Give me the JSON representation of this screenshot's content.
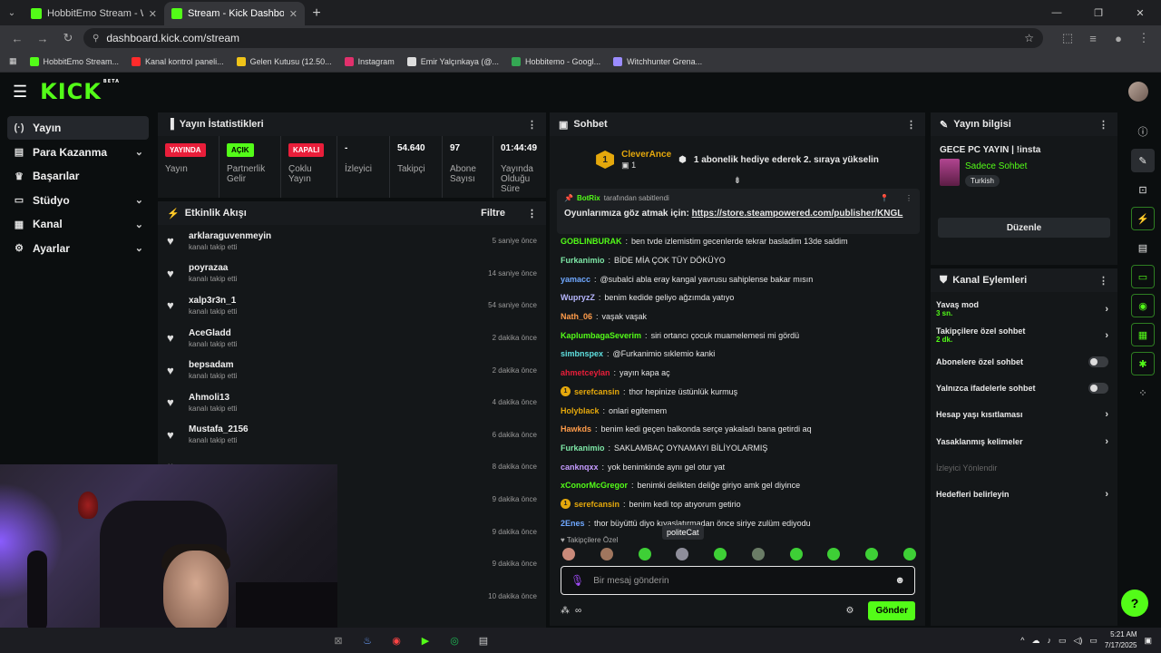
{
  "browser": {
    "tabs": [
      {
        "title": "HobbitEmo Stream - Watch Live",
        "active": false
      },
      {
        "title": "Stream - Kick Dashboard",
        "active": true
      }
    ],
    "url": "dashboard.kick.com/stream",
    "bookmarks": [
      {
        "label": "HobbitEmo Stream...",
        "color": "#53fc18"
      },
      {
        "label": "Kanal kontrol paneli...",
        "color": "#ff2b2b"
      },
      {
        "label": "Gelen Kutusu (12.50...",
        "color": "#f0c419"
      },
      {
        "label": "Instagram",
        "color": "#e1306c"
      },
      {
        "label": "Emir Yalçınkaya (@...",
        "color": "#dddddd"
      },
      {
        "label": "Hobbitemo - Googl...",
        "color": "#34a853"
      },
      {
        "label": "Witchhunter Grena...",
        "color": "#9b8cff"
      }
    ]
  },
  "kick": {
    "logo": "KICK",
    "beta": "BETA"
  },
  "sidebar": {
    "items": [
      {
        "label": "Yayın",
        "icon": "(·)",
        "active": true,
        "chevron": false
      },
      {
        "label": "Para Kazanma",
        "icon": "▤",
        "active": false,
        "chevron": true
      },
      {
        "label": "Başarılar",
        "icon": "🏆",
        "active": false,
        "chevron": false
      },
      {
        "label": "Stüdyo",
        "icon": "▭",
        "active": false,
        "chevron": true
      },
      {
        "label": "Kanal",
        "icon": "▦",
        "active": false,
        "chevron": true
      },
      {
        "label": "Ayarlar",
        "icon": "⚙",
        "active": false,
        "chevron": true
      }
    ]
  },
  "stats": {
    "title": "Yayın İstatistikleri",
    "cells": [
      {
        "badge": "YAYINDA",
        "badge_bg": "#e91e3a",
        "badge_fg": "#ffffff",
        "value": "",
        "label": "Yayın"
      },
      {
        "badge": "AÇIK",
        "badge_bg": "#53fc18",
        "badge_fg": "#000000",
        "value": "",
        "label": "Partnerlik Gelir"
      },
      {
        "badge": "KAPALI",
        "badge_bg": "#e91e3a",
        "badge_fg": "#ffffff",
        "value": "",
        "label": "Çoklu Yayın"
      },
      {
        "badge": "",
        "value": "-",
        "label": "İzleyici"
      },
      {
        "badge": "",
        "value": "54.640",
        "label": "Takipçi"
      },
      {
        "badge": "",
        "value": "97",
        "label": "Abone Sayısı"
      },
      {
        "badge": "",
        "value": "01:44:49",
        "label": "Yayında Olduğu Süre"
      }
    ]
  },
  "activity": {
    "title": "Etkinlik Akışı",
    "filter": "Filtre",
    "items": [
      {
        "name": "arklaraguvenmeyin",
        "sub": "kanalı takip etti",
        "time": "5 saniye önce"
      },
      {
        "name": "poyrazaa",
        "sub": "kanalı takip etti",
        "time": "14 saniye önce"
      },
      {
        "name": "xalp3r3n_1",
        "sub": "kanalı takip etti",
        "time": "54 saniye önce"
      },
      {
        "name": "AceGladd",
        "sub": "kanalı takip etti",
        "time": "2 dakika önce"
      },
      {
        "name": "bepsadam",
        "sub": "kanalı takip etti",
        "time": "2 dakika önce"
      },
      {
        "name": "Ahmoli13",
        "sub": "kanalı takip etti",
        "time": "4 dakika önce"
      },
      {
        "name": "Mustafa_2156",
        "sub": "kanalı takip etti",
        "time": "6 dakika önce"
      },
      {
        "name": "",
        "sub": "",
        "time": "8 dakika önce"
      },
      {
        "name": "",
        "sub": "",
        "time": "9 dakika önce"
      },
      {
        "name": "",
        "sub": "",
        "time": "9 dakika önce"
      },
      {
        "name": "",
        "sub": "",
        "time": "9 dakika önce"
      },
      {
        "name": "",
        "sub": "",
        "time": "10 dakika önce"
      }
    ]
  },
  "chat": {
    "title": "Sohbet",
    "gift": {
      "count": "1",
      "user": "CleverAnce",
      "sub_count": "1",
      "text": "1 abonelik hediye ederek 2. sıraya yükselin"
    },
    "pinned": {
      "by": "BotRix",
      "by_suffix": "tarafından sabitlendi",
      "text": "Oyunlarımıza göz atmak için:",
      "link": "https://store.steampowered.com/publisher/KNGL"
    },
    "messages": [
      {
        "user": "GOBLINBURAK",
        "color": "#53fc18",
        "badge": false,
        "text": "ben tvde izlemistim gecenlerde tekrar basladim 13de saldim"
      },
      {
        "user": "Furkanimio",
        "color": "#7ee8a7",
        "badge": false,
        "text": "BİDE MİA ÇOK TÜY DÖKÜYO"
      },
      {
        "user": "yamacc",
        "color": "#6fa8ff",
        "badge": false,
        "text": "@subalci abla eray kangal yavrusu sahiplense bakar mısın"
      },
      {
        "user": "WupryzZ",
        "color": "#b7b7ff",
        "badge": false,
        "text": "benim kedide geliyo ağzımda yatıyo"
      },
      {
        "user": "Nath_06",
        "color": "#ff9c4a",
        "badge": false,
        "text": "vaşak vaşak"
      },
      {
        "user": "KaplumbagaSeverim",
        "color": "#53fc18",
        "badge": false,
        "text": "siri ortancı çocuk muamelemesi mi gördü"
      },
      {
        "user": "simbnspex",
        "color": "#5fe0e0",
        "badge": false,
        "text": "@Furkanimio sıklemio kanki"
      },
      {
        "user": "ahmetceylan",
        "color": "#e91e3a",
        "badge": false,
        "text": "yayın kapa aç"
      },
      {
        "user": "serefcansin",
        "color": "#e5a80c",
        "badge": true,
        "text": "thor hepinize üstünlük kurmuş"
      },
      {
        "user": "Holyblack",
        "color": "#e5a80c",
        "badge": false,
        "text": "onlari egitemem"
      },
      {
        "user": "Hawkds",
        "color": "#ff9c4a",
        "badge": false,
        "text": "benim kedi geçen balkonda serçe yakaladı bana getirdi aq"
      },
      {
        "user": "Furkanimio",
        "color": "#7ee8a7",
        "badge": false,
        "text": "SAKLAMBAÇ OYNAMAYI BİLİYOLARMIŞ"
      },
      {
        "user": "canknqxx",
        "color": "#c59bff",
        "badge": false,
        "text": "yok benimkinde aynı gel otur yat"
      },
      {
        "user": "xConorMcGregor",
        "color": "#53fc18",
        "badge": false,
        "text": "benimki delikten deliğe giriyo amk gel diyince"
      },
      {
        "user": "serefcansin",
        "color": "#e5a80c",
        "badge": true,
        "text": "benim kedi top atıyorum getirio"
      },
      {
        "user": "2Enes",
        "color": "#6fa8ff",
        "badge": false,
        "text": "thor büyüttü diyo kıyaslatırmadan önce siriye zulüm ediyodu"
      }
    ],
    "followers_only": "Takipçilere Özel",
    "tooltip": "politeCat",
    "placeholder": "Bir mesaj gönderin",
    "send": "Gönder"
  },
  "stream_info": {
    "title": "Yayın bilgisi",
    "stream_title": "GECE PC YAYIN | !insta",
    "category": "Sadece Sohbet",
    "tag": "Turkish",
    "edit": "Düzenle"
  },
  "channel_actions": {
    "title": "Kanal Eylemleri",
    "items": [
      {
        "label": "Yavaş mod",
        "sub": "3 sn.",
        "control": "arrow"
      },
      {
        "label": "Takipçilere özel sohbet",
        "sub": "2 dk.",
        "control": "arrow"
      },
      {
        "label": "Abonelere özel sohbet",
        "sub": "",
        "control": "toggle"
      },
      {
        "label": "Yalnızca ifadelerle sohbet",
        "sub": "",
        "control": "toggle"
      },
      {
        "label": "Hesap yaşı kısıtlaması",
        "sub": "",
        "control": "arrow"
      },
      {
        "label": "Yasaklanmış kelimeler",
        "sub": "",
        "control": "arrow"
      },
      {
        "label": "İzleyici Yönlendir",
        "sub": "",
        "control": "none",
        "disabled": true
      },
      {
        "label": "Hedefleri belirleyin",
        "sub": "",
        "control": "arrow"
      }
    ]
  },
  "taskbar": {
    "time": "5:21 AM",
    "date": "7/17/2025"
  }
}
